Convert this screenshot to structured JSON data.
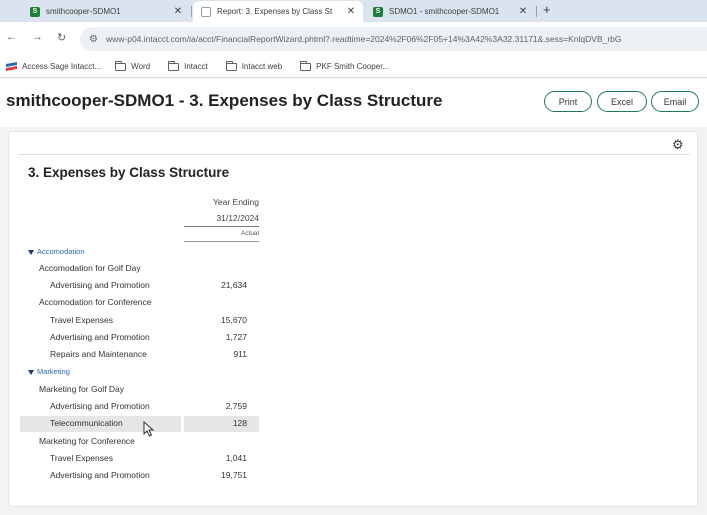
{
  "browser": {
    "tabs": [
      {
        "title": "smithcooper-SDMO1",
        "favicon": "S",
        "active": false
      },
      {
        "title": "Report: 3. Expenses by Class St",
        "favicon": "",
        "active": true
      },
      {
        "title": "SDMO1 - smithcooper-SDMO1",
        "favicon": "S",
        "active": false
      }
    ],
    "new_tab": "+",
    "url": "www-p04.intacct.com/ia/acct/FinancialReportWizard.phtml?.readtime=2024%2F06%2F05+14%3A42%3A32.31171&.sess=KnlqDVB_rbG",
    "bookmarks": [
      {
        "label": "Access Sage Intacct...",
        "icon": "sage-logo-icon"
      },
      {
        "label": "Word",
        "icon": "folder-icon"
      },
      {
        "label": "Intacct",
        "icon": "folder-icon"
      },
      {
        "label": "Intacct web",
        "icon": "folder-icon"
      },
      {
        "label": "PKF Smith Cooper...",
        "icon": "folder-icon"
      }
    ]
  },
  "page": {
    "title": "smithcooper-SDMO1 - 3. Expenses by Class Structure",
    "buttons": {
      "print": "Print",
      "excel": "Excel",
      "email": "Email"
    },
    "accent_color": "#1e7b4f"
  },
  "report": {
    "title": "3. Expenses by Class Structure",
    "column": {
      "line1": "Year Ending",
      "line2": "31/12/2024",
      "sub": "Actual"
    },
    "rows": [
      {
        "type": "section",
        "label": "Accomodation"
      },
      {
        "type": "group",
        "label": "Accomodation for Golf Day"
      },
      {
        "type": "item",
        "label": "Advertising and Promotion",
        "value": "21,634"
      },
      {
        "type": "group",
        "label": "Accomodation for Conference"
      },
      {
        "type": "item",
        "label": "Travel Expenses",
        "value": "15,670"
      },
      {
        "type": "item",
        "label": "Advertising and Promotion",
        "value": "1,727"
      },
      {
        "type": "item",
        "label": "Repairs and Maintenance",
        "value": "911"
      },
      {
        "type": "section",
        "label": "Marketing"
      },
      {
        "type": "group",
        "label": "Marketing for Golf Day"
      },
      {
        "type": "item",
        "label": "Advertising and Promotion",
        "value": "2,759"
      },
      {
        "type": "item",
        "label": "Telecommunication",
        "value": "128",
        "highlighted": true
      },
      {
        "type": "group",
        "label": "Marketing for Conference"
      },
      {
        "type": "item",
        "label": "Travel Expenses",
        "value": "1,041"
      },
      {
        "type": "item",
        "label": "Advertising and Promotion",
        "value": "19,751"
      }
    ]
  }
}
